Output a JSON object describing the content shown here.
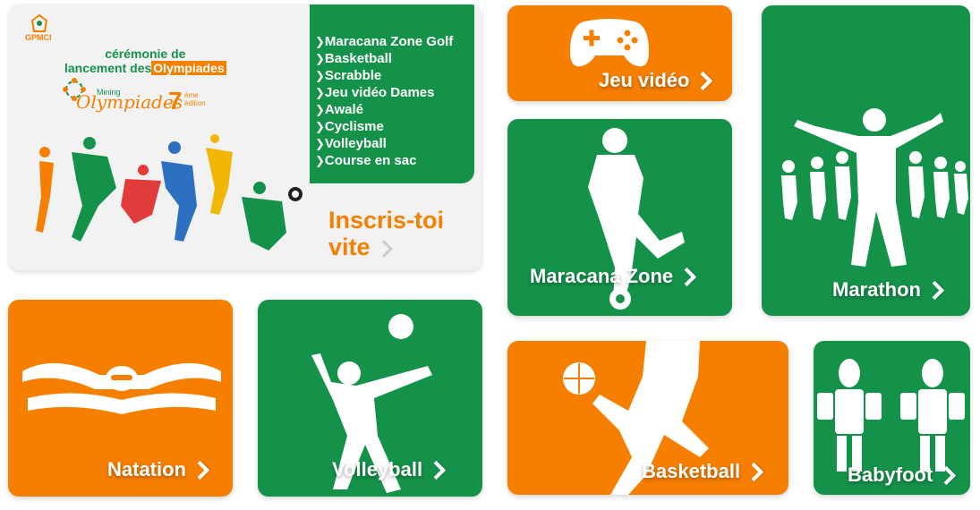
{
  "banner": {
    "org": "GPMCI",
    "title_line1": "cérémonie de",
    "title_line2_prefix": "lancement des",
    "title_highlight": "Olympiades",
    "brand_small": "Mining",
    "brand": "Olympiades",
    "edition_num": "7",
    "edition_suffix_top": "ème",
    "edition_suffix_bottom": "édition",
    "disciplines": [
      "Maracana Zone Golf",
      "Basketball",
      "Scrabble",
      "Jeu vidéo Dames",
      "Awalé",
      "Cyclisme",
      "Volleyball",
      "Course en sac"
    ],
    "cta_line1": "Inscris-toi",
    "cta_line2": "vite"
  },
  "tiles": {
    "jeu_video": "Jeu vidéo",
    "maracana": "Maracana Zone",
    "marathon": "Marathon",
    "natation": "Natation",
    "volleyball": "Volleyball",
    "basketball": "Basketball",
    "babyfoot": "Babyfoot"
  },
  "colors": {
    "orange": "#f77f00",
    "green": "#15924a",
    "banner_bg": "#f2f2f2"
  }
}
